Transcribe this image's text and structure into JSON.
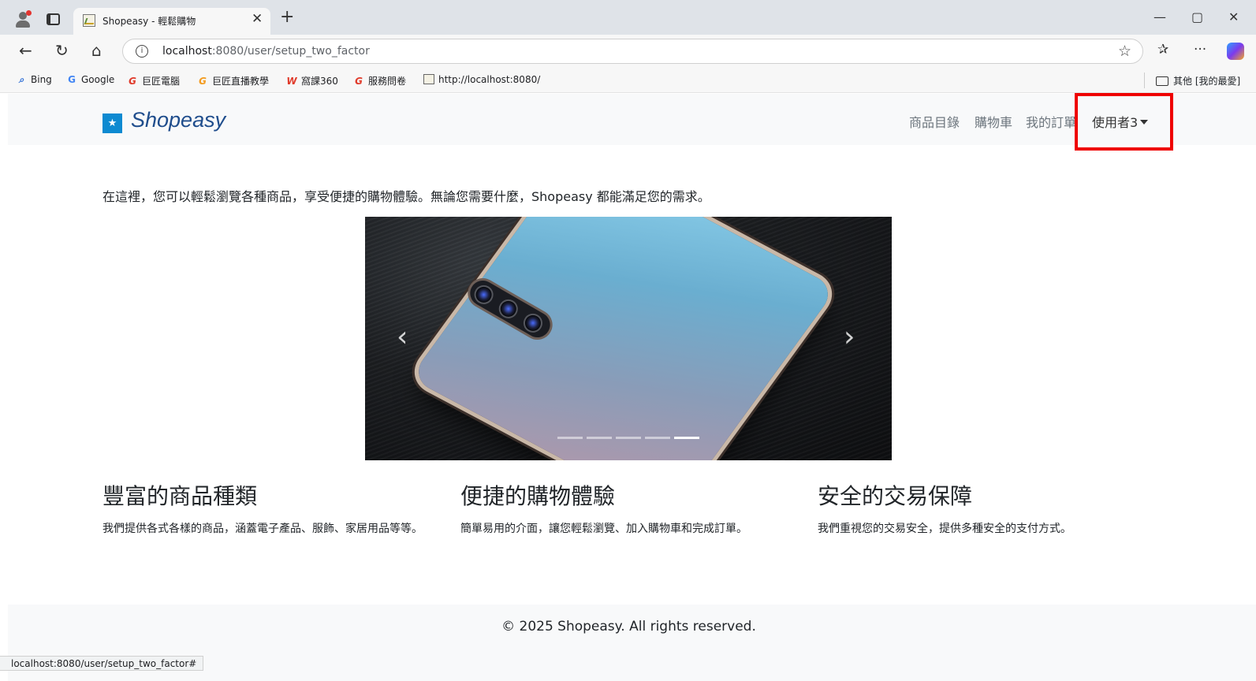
{
  "browser": {
    "tab_title": "Shopeasy - 輕鬆購物",
    "url_host": "localhost",
    "url_path": ":8080/user/setup_two_factor",
    "bookmarks": [
      {
        "label": "Bing",
        "icon": "search-icon"
      },
      {
        "label": "Google",
        "icon": "google-icon"
      },
      {
        "label": "巨匠電腦",
        "icon": "gjun-icon"
      },
      {
        "label": "巨匠直播教學",
        "icon": "gjun-live-icon"
      },
      {
        "label": "窩課360",
        "icon": "wocom-icon"
      },
      {
        "label": "服務問卷",
        "icon": "survey-icon"
      },
      {
        "label": "http://localhost:8080/",
        "icon": "page-icon"
      }
    ],
    "other_favorites": "其他 [我的最愛]",
    "status_url": "localhost:8080/user/setup_two_factor#"
  },
  "navbar": {
    "brand": "Shopeasy",
    "links": [
      "商品目錄",
      "購物車",
      "我的訂單"
    ],
    "user_menu": "使用者3"
  },
  "intro": "在這裡，您可以輕鬆瀏覽各種商品，享受便捷的購物體驗。無論您需要什麼，Shopeasy 都能滿足您的需求。",
  "carousel": {
    "slide_count": 5,
    "active_index": 4,
    "prev_icon": "chevron-left-icon",
    "next_icon": "chevron-right-icon"
  },
  "features": [
    {
      "title": "豐富的商品種類",
      "text": "我們提供各式各樣的商品，涵蓋電子產品、服飾、家居用品等等。"
    },
    {
      "title": "便捷的購物體驗",
      "text": "簡單易用的介面，讓您輕鬆瀏覽、加入購物車和完成訂單。"
    },
    {
      "title": "安全的交易保障",
      "text": "我們重視您的交易安全，提供多種安全的支付方式。"
    }
  ],
  "footer": "© 2025 Shopeasy. All rights reserved.",
  "colors": {
    "highlight": "#ef0000",
    "brand": "#1f4d8c",
    "navbar_bg": "#f8f9fa"
  }
}
